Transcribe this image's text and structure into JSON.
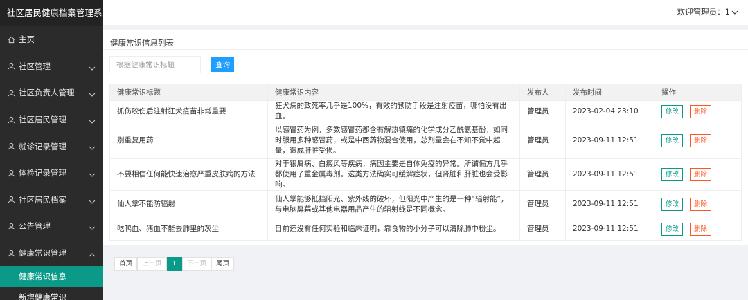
{
  "app": {
    "title": "社区居民健康档案管理系",
    "welcome": "欢迎管理员：1"
  },
  "sidebar": {
    "items": [
      {
        "label": "主页",
        "icon": "home-icon"
      },
      {
        "label": "社区管理",
        "icon": "user-icon"
      },
      {
        "label": "社区负责人管理",
        "icon": "user-icon"
      },
      {
        "label": "社区居民管理",
        "icon": "user-icon"
      },
      {
        "label": "就诊记录管理",
        "icon": "user-icon"
      },
      {
        "label": "体检记录管理",
        "icon": "user-icon"
      },
      {
        "label": "社区居民档案",
        "icon": "user-icon"
      },
      {
        "label": "公告管理",
        "icon": "user-icon"
      },
      {
        "label": "健康常识管理",
        "icon": "user-icon",
        "expanded": true
      }
    ],
    "subitems": [
      {
        "label": "健康常识信息",
        "active": true
      },
      {
        "label": "新增健康常识",
        "active": false
      }
    ]
  },
  "main": {
    "panel_title": "健康常识信息列表",
    "search": {
      "placeholder": "根据健康常识标题",
      "value": ""
    },
    "query_label": "查询",
    "table": {
      "headers": [
        "健康常识标题",
        "健康常识内容",
        "发布人",
        "发布时间",
        "操作"
      ],
      "rows": [
        {
          "title": "抓伤咬伤后注射狂犬疫苗非常重要",
          "content": "狂犬病的致死率几乎是100%，有效的预防手段是注射疫苗，哪怕没有出血。",
          "publisher": "管理员",
          "time": "2023-02-04 23:10"
        },
        {
          "title": "别重复用药",
          "content": "以感冒药为例，多数感冒药都含有解热镇痛的化学成分乙酰氨基酚，如同时服用多种感冒药，或是中西药物混合使用，总剂量会在不知不觉中超量，造成肝脏受损。",
          "publisher": "管理员",
          "time": "2023-09-11 12:51"
        },
        {
          "title": "不要相信任何能快速治愈严重皮肤病的方法",
          "content": "对于银屑病、白癜风等疾病，病因主要是自体免疫的异常。所谓偏方几乎都使用了重金属毒剂。这类方法确实可缓解症状，但肾脏和肝脏也会受影响。",
          "publisher": "管理员",
          "time": "2023-09-11 12:51"
        },
        {
          "title": "仙人掌不能防辐射",
          "content": "仙人掌能够抵挡阳光、紫外线的破坏，但阳光中产生的是一种“辐射能”，与电脑屏幕或其他电器用品产生的辐射线是不同概念。",
          "publisher": "管理员",
          "time": "2023-09-11 12:51"
        },
        {
          "title": "吃鸭血、猪血不能去肺里的灰尘",
          "content": "目前还没有任何实验和临床证明，靠食物的小分子可以清除肺中粉尘。",
          "publisher": "管理员",
          "time": "2023-09-11 12:51"
        }
      ],
      "edit_label": "修改",
      "delete_label": "删除"
    },
    "pager": {
      "first": "首页",
      "prev": "上一页",
      "current": "1",
      "next": "下一页",
      "last": "尾页"
    }
  },
  "colors": {
    "sidebar_bg": "#2b2b2b",
    "active": "#0b9a88",
    "query": "#1e9fff",
    "danger": "#ff5722"
  }
}
